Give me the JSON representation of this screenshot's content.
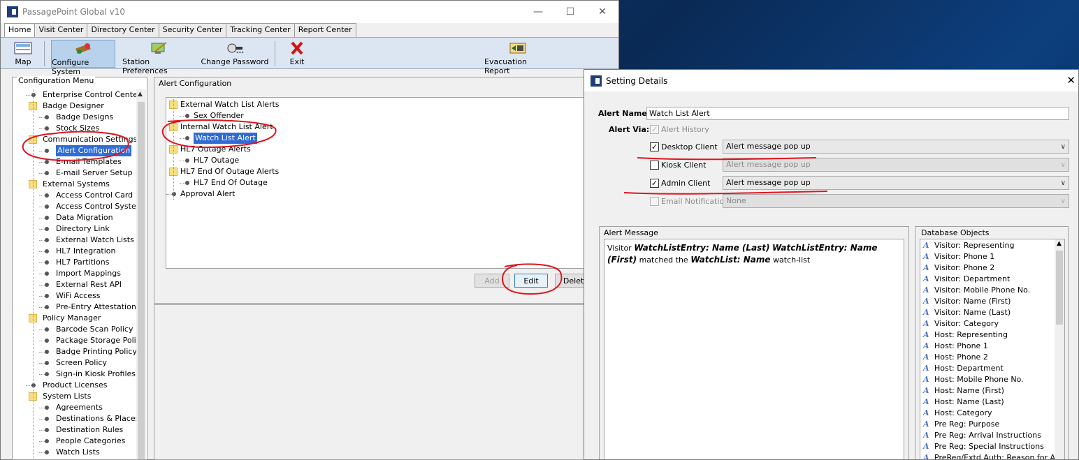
{
  "main_window": {
    "title": "PassagePoint Global v10",
    "tabs": [
      "Home",
      "Visit Center",
      "Directory Center",
      "Security Center",
      "Tracking Center",
      "Report Center"
    ],
    "toolbar": {
      "map": "Map",
      "configure_system": "Configure System",
      "station_preferences": "Station Preferences",
      "change_password": "Change Password",
      "exit": "Exit",
      "evacuation_report": "Evacuation Report"
    },
    "config_menu": {
      "title": "Configuration Menu",
      "items": [
        {
          "label": "Enterprise Control Center",
          "type": "leaf",
          "level": 0
        },
        {
          "label": "Badge Designer",
          "type": "folder",
          "level": 0
        },
        {
          "label": "Badge Designs",
          "type": "leaf",
          "level": 1
        },
        {
          "label": "Stock Sizes",
          "type": "leaf",
          "level": 1
        },
        {
          "label": "Communication Settings",
          "type": "folder",
          "level": 0
        },
        {
          "label": "Alert Configuration",
          "type": "leaf",
          "level": 1,
          "selected": true
        },
        {
          "label": "E-mail Templates",
          "type": "leaf",
          "level": 1
        },
        {
          "label": "E-mail Server Setup",
          "type": "leaf",
          "level": 1
        },
        {
          "label": "External Systems",
          "type": "folder",
          "level": 0
        },
        {
          "label": "Access Control Card",
          "type": "leaf",
          "level": 1
        },
        {
          "label": "Access Control Systems",
          "type": "leaf",
          "level": 1
        },
        {
          "label": "Data Migration",
          "type": "leaf",
          "level": 1
        },
        {
          "label": "Directory Link",
          "type": "leaf",
          "level": 1
        },
        {
          "label": "External Watch Lists",
          "type": "leaf",
          "level": 1
        },
        {
          "label": "HL7 Integration",
          "type": "leaf",
          "level": 1
        },
        {
          "label": "HL7 Partitions",
          "type": "leaf",
          "level": 1
        },
        {
          "label": "Import Mappings",
          "type": "leaf",
          "level": 1
        },
        {
          "label": "External Rest API",
          "type": "leaf",
          "level": 1
        },
        {
          "label": "WiFi Access",
          "type": "leaf",
          "level": 1
        },
        {
          "label": "Pre-Entry Attestation",
          "type": "leaf",
          "level": 1
        },
        {
          "label": "Policy Manager",
          "type": "folder",
          "level": 0
        },
        {
          "label": "Barcode Scan Policy",
          "type": "leaf",
          "level": 1
        },
        {
          "label": "Package Storage Policy",
          "type": "leaf",
          "level": 1
        },
        {
          "label": "Badge Printing Policy",
          "type": "leaf",
          "level": 1
        },
        {
          "label": "Screen Policy",
          "type": "leaf",
          "level": 1
        },
        {
          "label": "Sign-in Kiosk Profiles",
          "type": "leaf",
          "level": 1
        },
        {
          "label": "Product Licenses",
          "type": "leaf",
          "level": 0
        },
        {
          "label": "System Lists",
          "type": "folder",
          "level": 0
        },
        {
          "label": "Agreements",
          "type": "leaf",
          "level": 1
        },
        {
          "label": "Destinations & Places",
          "type": "leaf",
          "level": 1
        },
        {
          "label": "Destination Rules",
          "type": "leaf",
          "level": 1
        },
        {
          "label": "People Categories",
          "type": "leaf",
          "level": 1
        },
        {
          "label": "Watch Lists",
          "type": "leaf",
          "level": 1
        }
      ]
    },
    "alert_config": {
      "title": "Alert Configuration",
      "items": [
        {
          "label": "External Watch List Alerts",
          "type": "folder",
          "level": 0
        },
        {
          "label": "Sex Offender",
          "type": "leaf",
          "level": 1
        },
        {
          "label": "Internal Watch List Alert",
          "type": "folder",
          "level": 0
        },
        {
          "label": "Watch List Alert",
          "type": "leaf",
          "level": 1,
          "selected": true
        },
        {
          "label": "HL7 Outage Alerts",
          "type": "folder",
          "level": 0
        },
        {
          "label": "HL7 Outage",
          "type": "leaf",
          "level": 1
        },
        {
          "label": "HL7 End Of Outage Alerts",
          "type": "folder",
          "level": 0
        },
        {
          "label": "HL7 End Of Outage",
          "type": "leaf",
          "level": 1
        },
        {
          "label": "Approval Alert",
          "type": "leaf",
          "level": 0
        }
      ],
      "add_label": "Add",
      "edit_label": "Edit",
      "delete_label": "Delete"
    }
  },
  "dialog": {
    "title": "Setting Details",
    "alert_name_label": "Alert Name:",
    "alert_name_value": "Watch List Alert",
    "alert_via_label": "Alert Via:",
    "alert_history": "Alert History",
    "channels": [
      {
        "label": "Desktop Client",
        "checked": true,
        "enabled": true,
        "value": "Alert message pop up"
      },
      {
        "label": "Kiosk Client",
        "checked": false,
        "enabled": true,
        "value": "Alert message pop up",
        "combo_disabled": true
      },
      {
        "label": "Admin Client",
        "checked": true,
        "enabled": true,
        "value": "Alert message pop up"
      },
      {
        "label": "Email Notification",
        "checked": false,
        "enabled": false,
        "value": "None",
        "combo_disabled": true
      }
    ],
    "alert_message_title": "Alert Message",
    "message": {
      "w1": "Visitor",
      "t1": "WatchListEntry: Name (Last)",
      "t2": "WatchListEntry: Name (First)",
      "w2": "matched",
      "w3": "the",
      "t3": "WatchList: Name",
      "w4": "watch-list"
    },
    "db_objects_title": "Database Objects",
    "db_objects": [
      "Visitor: Representing",
      "Visitor: Phone 1",
      "Visitor: Phone 2",
      "Visitor: Department",
      "Visitor: Mobile Phone No.",
      "Visitor: Name (First)",
      "Visitor: Name (Last)",
      "Visitor: Category",
      "Host: Representing",
      "Host: Phone 1",
      "Host: Phone 2",
      "Host: Department",
      "Host: Mobile Phone No.",
      "Host: Name (First)",
      "Host: Name (Last)",
      "Host: Category",
      "Pre Reg: Purpose",
      "Pre Reg: Arrival Instructions",
      "Pre Reg: Special Instructions",
      "PreReg/Extd Auth: Reason for App"
    ]
  },
  "colors": {
    "selection": "#2f6cd6",
    "annotation": "#e0141e",
    "toolbar_bg": "#dce6f2"
  }
}
